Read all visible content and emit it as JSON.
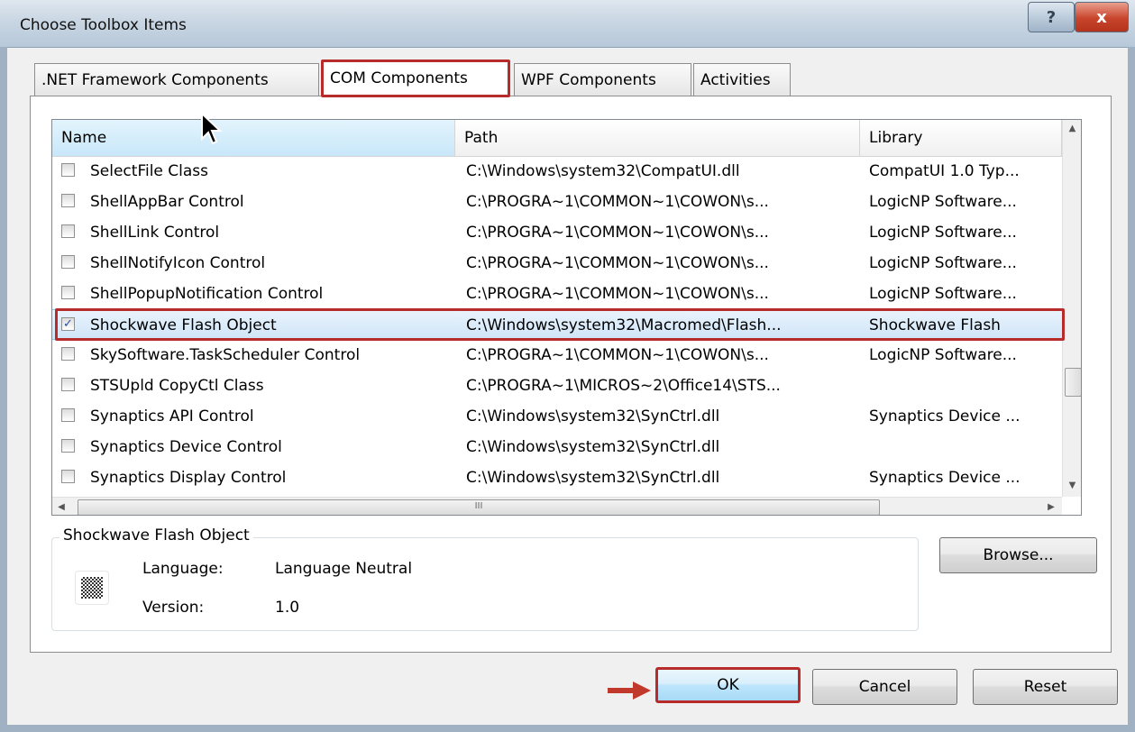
{
  "window": {
    "title": "Choose Toolbox Items",
    "help_glyph": "?",
    "close_glyph": "x"
  },
  "tabs": [
    {
      "label": ".NET Framework Components"
    },
    {
      "label": "COM Components"
    },
    {
      "label": "WPF Components"
    },
    {
      "label": "Activities"
    }
  ],
  "list": {
    "columns": [
      "Name",
      "Path",
      "Library"
    ],
    "rows": [
      {
        "checked": false,
        "name": "SelectFile Class",
        "path": "C:\\Windows\\system32\\CompatUI.dll",
        "library": "CompatUI 1.0 Typ..."
      },
      {
        "checked": false,
        "name": "ShellAppBar Control",
        "path": "C:\\PROGRA~1\\COMMON~1\\COWON\\s...",
        "library": "LogicNP Software..."
      },
      {
        "checked": false,
        "name": "ShellLink Control",
        "path": "C:\\PROGRA~1\\COMMON~1\\COWON\\s...",
        "library": "LogicNP Software..."
      },
      {
        "checked": false,
        "name": "ShellNotifyIcon Control",
        "path": "C:\\PROGRA~1\\COMMON~1\\COWON\\s...",
        "library": "LogicNP Software..."
      },
      {
        "checked": false,
        "name": "ShellPopupNotification Control",
        "path": "C:\\PROGRA~1\\COMMON~1\\COWON\\s...",
        "library": "LogicNP Software..."
      },
      {
        "checked": true,
        "selected": true,
        "name": "Shockwave Flash Object",
        "path": "C:\\Windows\\system32\\Macromed\\Flash...",
        "library": "Shockwave Flash"
      },
      {
        "checked": false,
        "name": "SkySoftware.TaskScheduler Control",
        "path": "C:\\PROGRA~1\\COMMON~1\\COWON\\s...",
        "library": "LogicNP Software..."
      },
      {
        "checked": false,
        "name": "STSUpld CopyCtl Class",
        "path": "C:\\PROGRA~1\\MICROS~2\\Office14\\STS...",
        "library": ""
      },
      {
        "checked": false,
        "name": "Synaptics API Control",
        "path": "C:\\Windows\\system32\\SynCtrl.dll",
        "library": "Synaptics Device ..."
      },
      {
        "checked": false,
        "name": "Synaptics Device Control",
        "path": "C:\\Windows\\system32\\SynCtrl.dll",
        "library": ""
      },
      {
        "checked": false,
        "name": "Synaptics Display Control",
        "path": "C:\\Windows\\system32\\SynCtrl.dll",
        "library": "Synaptics Device ..."
      }
    ],
    "hscroll_thumb_grip": "III",
    "check_glyph": "✓"
  },
  "details": {
    "title": "Shockwave Flash Object",
    "language_label": "Language:",
    "language_value": "Language Neutral",
    "version_label": "Version:",
    "version_value": "1.0"
  },
  "buttons": {
    "browse": "Browse...",
    "ok": "OK",
    "cancel": "Cancel",
    "reset": "Reset"
  },
  "colors": {
    "highlight_red": "#b72b2b",
    "selection_blue": "#cfe4f7"
  }
}
